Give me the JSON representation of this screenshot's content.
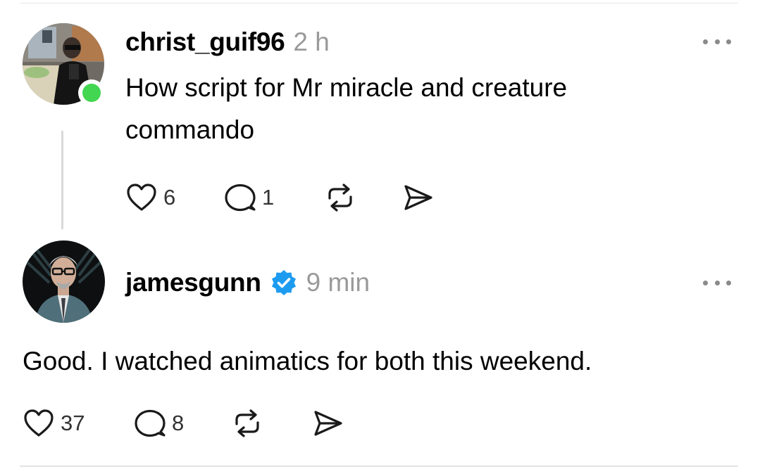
{
  "posts": [
    {
      "username": "christ_guif96",
      "timestamp": "2 h",
      "text": "How script for Mr miracle and creature commando",
      "online": true,
      "verified": false,
      "likes": "6",
      "replies": "1"
    },
    {
      "username": "jamesgunn",
      "timestamp": "9 min",
      "text": "Good. I watched animatics for both this weekend.",
      "online": false,
      "verified": true,
      "likes": "37",
      "replies": "8"
    }
  ],
  "icons": {
    "like": "heart-icon",
    "reply": "comment-bubble-icon",
    "repost": "repost-arrows-icon",
    "share": "send-paper-plane-icon",
    "more": "ellipsis-icon",
    "verified": "verified-badge-icon"
  },
  "colors": {
    "verified_badge": "#1d9bf0",
    "online_indicator": "#42d651",
    "timestamp": "#9a9a9a"
  }
}
